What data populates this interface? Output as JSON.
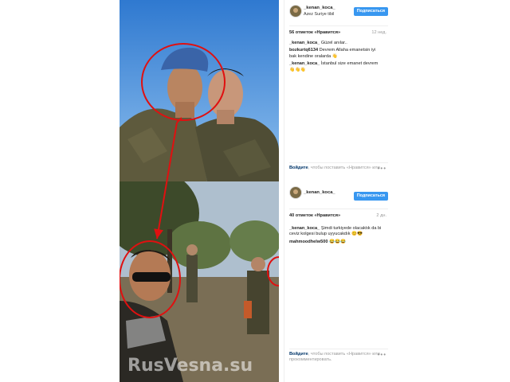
{
  "post1": {
    "username": "_kenan_koca_",
    "location": "Azez Suriye tibil",
    "follow_label": "Подписаться",
    "likes": "56 отметок «Нравится»",
    "age": "12 нед.",
    "comments": [
      {
        "user": "_kenan_koca_",
        "text": "Güzel anılar.."
      },
      {
        "user": "bozkurtq6134",
        "text": "Devrem Allaha emanetsin iyi bak kendine oralarda 👋"
      },
      {
        "user": "_kenan_koca_",
        "text": "İstanbul size emanet devrem 👋👋👋"
      }
    ],
    "login_link": "Войдите",
    "login_text": ", чтобы поставить «Нравится» или",
    "more": "•••"
  },
  "post2": {
    "username": "_kenan_koca_",
    "follow_label": "Подписаться",
    "likes": "40 отметок «Нравится»",
    "age": "2 дн.",
    "comments": [
      {
        "user": "_kenan_koca_",
        "text": "Şimdi turkiyede olacaktık da bi ceviz kolgesi bulup uyyucakdık 😊😎"
      },
      {
        "user": "mahmoodhelw500",
        "text": "😂😂😂"
      }
    ],
    "login_link": "Войдите",
    "login_text": ", чтобы поставить «Нравится» или прокомментировать.",
    "more": "•••"
  },
  "watermark": "RusVesna.su",
  "colors": {
    "follow_button": "#3897f0",
    "annotation_red": "#e01010",
    "sky": "#4f8fd6",
    "uniform": "#5c5a3e"
  }
}
